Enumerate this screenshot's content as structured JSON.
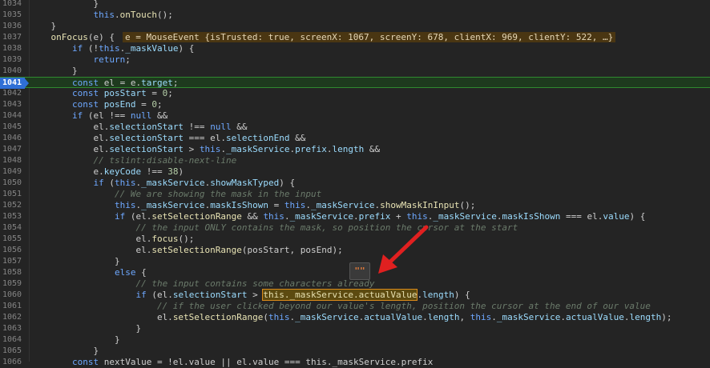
{
  "lines": [
    {
      "n": "1034",
      "segs": [
        {
          "t": "            }",
          "c": "op"
        }
      ]
    },
    {
      "n": "1035",
      "segs": [
        {
          "t": "            this",
          "c": "kw"
        },
        {
          "t": ".",
          "c": "op"
        },
        {
          "t": "onTouch",
          "c": "fn"
        },
        {
          "t": "();",
          "c": "op"
        }
      ]
    },
    {
      "n": "1036",
      "segs": [
        {
          "t": "    }",
          "c": "op"
        }
      ]
    },
    {
      "n": "1037",
      "segs": [
        {
          "t": "    onFocus",
          "c": "fn"
        },
        {
          "t": "(e) {",
          "c": "op"
        }
      ],
      "inline": "e = MouseEvent {isTrusted: true, screenX: 1067, screenY: 678, clientX: 969, clientY: 522, …}"
    },
    {
      "n": "1038",
      "segs": [
        {
          "t": "        if",
          "c": "kw"
        },
        {
          "t": " (!",
          "c": "op"
        },
        {
          "t": "this",
          "c": "kw"
        },
        {
          "t": ".",
          "c": "op"
        },
        {
          "t": "_maskValue",
          "c": "pr"
        },
        {
          "t": ") {",
          "c": "op"
        }
      ]
    },
    {
      "n": "1039",
      "segs": [
        {
          "t": "            return",
          "c": "kw"
        },
        {
          "t": ";",
          "c": "op"
        }
      ]
    },
    {
      "n": "1040",
      "segs": [
        {
          "t": "        }",
          "c": "op"
        }
      ]
    },
    {
      "n": "1041",
      "current": true,
      "segs": [
        {
          "t": "        const",
          "c": "kw"
        },
        {
          "t": " el = e.",
          "c": "op"
        },
        {
          "t": "target",
          "c": "pr"
        },
        {
          "t": ";",
          "c": "op"
        }
      ]
    },
    {
      "n": "1042",
      "segs": [
        {
          "t": "        const",
          "c": "kw"
        },
        {
          "t": " ",
          "c": "op"
        },
        {
          "t": "posStart",
          "c": "pr"
        },
        {
          "t": " = ",
          "c": "op"
        },
        {
          "t": "0",
          "c": "nm"
        },
        {
          "t": ";",
          "c": "op"
        }
      ]
    },
    {
      "n": "1043",
      "segs": [
        {
          "t": "        const",
          "c": "kw"
        },
        {
          "t": " ",
          "c": "op"
        },
        {
          "t": "posEnd",
          "c": "pr"
        },
        {
          "t": " = ",
          "c": "op"
        },
        {
          "t": "0",
          "c": "nm"
        },
        {
          "t": ";",
          "c": "op"
        }
      ]
    },
    {
      "n": "1044",
      "segs": [
        {
          "t": "        if",
          "c": "kw"
        },
        {
          "t": " (el !== ",
          "c": "op"
        },
        {
          "t": "null",
          "c": "kw"
        },
        {
          "t": " &&",
          "c": "op"
        }
      ]
    },
    {
      "n": "1045",
      "segs": [
        {
          "t": "            el.",
          "c": "op"
        },
        {
          "t": "selectionStart",
          "c": "pr"
        },
        {
          "t": " !== ",
          "c": "op"
        },
        {
          "t": "null",
          "c": "kw"
        },
        {
          "t": " &&",
          "c": "op"
        }
      ]
    },
    {
      "n": "1046",
      "segs": [
        {
          "t": "            el.",
          "c": "op"
        },
        {
          "t": "selectionStart",
          "c": "pr"
        },
        {
          "t": " === el.",
          "c": "op"
        },
        {
          "t": "selectionEnd",
          "c": "pr"
        },
        {
          "t": " &&",
          "c": "op"
        }
      ]
    },
    {
      "n": "1047",
      "segs": [
        {
          "t": "            el.",
          "c": "op"
        },
        {
          "t": "selectionStart",
          "c": "pr"
        },
        {
          "t": " > ",
          "c": "op"
        },
        {
          "t": "this",
          "c": "kw"
        },
        {
          "t": ".",
          "c": "op"
        },
        {
          "t": "_maskService",
          "c": "pr"
        },
        {
          "t": ".",
          "c": "op"
        },
        {
          "t": "prefix",
          "c": "pr"
        },
        {
          "t": ".",
          "c": "op"
        },
        {
          "t": "length",
          "c": "pr"
        },
        {
          "t": " &&",
          "c": "op"
        }
      ]
    },
    {
      "n": "1048",
      "segs": [
        {
          "t": "            // tslint:disable-next-line",
          "c": "cm"
        }
      ]
    },
    {
      "n": "1049",
      "segs": [
        {
          "t": "            e.",
          "c": "op"
        },
        {
          "t": "keyCode",
          "c": "pr"
        },
        {
          "t": " !== ",
          "c": "op"
        },
        {
          "t": "38",
          "c": "nm"
        },
        {
          "t": ")",
          "c": "op"
        }
      ]
    },
    {
      "n": "1050",
      "segs": [
        {
          "t": "            if",
          "c": "kw"
        },
        {
          "t": " (",
          "c": "op"
        },
        {
          "t": "this",
          "c": "kw"
        },
        {
          "t": ".",
          "c": "op"
        },
        {
          "t": "_maskService",
          "c": "pr"
        },
        {
          "t": ".",
          "c": "op"
        },
        {
          "t": "showMaskTyped",
          "c": "pr"
        },
        {
          "t": ") {",
          "c": "op"
        }
      ]
    },
    {
      "n": "1051",
      "segs": [
        {
          "t": "                // We are showing the mask in the input",
          "c": "cm"
        }
      ]
    },
    {
      "n": "1052",
      "segs": [
        {
          "t": "                this",
          "c": "kw"
        },
        {
          "t": ".",
          "c": "op"
        },
        {
          "t": "_maskService",
          "c": "pr"
        },
        {
          "t": ".",
          "c": "op"
        },
        {
          "t": "maskIsShown",
          "c": "pr"
        },
        {
          "t": " = ",
          "c": "op"
        },
        {
          "t": "this",
          "c": "kw"
        },
        {
          "t": ".",
          "c": "op"
        },
        {
          "t": "_maskService",
          "c": "pr"
        },
        {
          "t": ".",
          "c": "op"
        },
        {
          "t": "showMaskInInput",
          "c": "fn"
        },
        {
          "t": "();",
          "c": "op"
        }
      ]
    },
    {
      "n": "1053",
      "segs": [
        {
          "t": "                if",
          "c": "kw"
        },
        {
          "t": " (el.",
          "c": "op"
        },
        {
          "t": "setSelectionRange",
          "c": "fn"
        },
        {
          "t": " && ",
          "c": "op"
        },
        {
          "t": "this",
          "c": "kw"
        },
        {
          "t": ".",
          "c": "op"
        },
        {
          "t": "_maskService",
          "c": "pr"
        },
        {
          "t": ".",
          "c": "op"
        },
        {
          "t": "prefix",
          "c": "pr"
        },
        {
          "t": " + ",
          "c": "op"
        },
        {
          "t": "this",
          "c": "kw"
        },
        {
          "t": ".",
          "c": "op"
        },
        {
          "t": "_maskService",
          "c": "pr"
        },
        {
          "t": ".",
          "c": "op"
        },
        {
          "t": "maskIsShown",
          "c": "pr"
        },
        {
          "t": " === el.",
          "c": "op"
        },
        {
          "t": "value",
          "c": "pr"
        },
        {
          "t": ") {",
          "c": "op"
        }
      ]
    },
    {
      "n": "1054",
      "segs": [
        {
          "t": "                    // the input ONLY contains the mask, so position the cursor at the start",
          "c": "cm"
        }
      ]
    },
    {
      "n": "1055",
      "segs": [
        {
          "t": "                    el.",
          "c": "op"
        },
        {
          "t": "focus",
          "c": "fn"
        },
        {
          "t": "();",
          "c": "op"
        }
      ]
    },
    {
      "n": "1056",
      "segs": [
        {
          "t": "                    el.",
          "c": "op"
        },
        {
          "t": "setSelectionRange",
          "c": "fn"
        },
        {
          "t": "(posStart, posEnd);",
          "c": "op"
        }
      ]
    },
    {
      "n": "1057",
      "segs": [
        {
          "t": "                }",
          "c": "op"
        }
      ]
    },
    {
      "n": "1058",
      "segs": [
        {
          "t": "                else",
          "c": "kw"
        },
        {
          "t": " {",
          "c": "op"
        }
      ]
    },
    {
      "n": "1059",
      "segs": [
        {
          "t": "                    // the input contains some characters alr",
          "c": "cm"
        },
        {
          "t": "eady",
          "c": "cm"
        }
      ]
    },
    {
      "n": "1060",
      "segs": [
        {
          "t": "                    if",
          "c": "kw"
        },
        {
          "t": " (el.",
          "c": "op"
        },
        {
          "t": "selectionStart",
          "c": "pr"
        },
        {
          "t": " > ",
          "c": "op"
        },
        {
          "t": "this._maskService.actualValue",
          "c": "hl"
        },
        {
          "t": ".",
          "c": "op"
        },
        {
          "t": "length",
          "c": "pr"
        },
        {
          "t": ") {",
          "c": "op"
        }
      ]
    },
    {
      "n": "1061",
      "segs": [
        {
          "t": "                        // if the user clicked beyond our value's length, position the cursor at the end of our value",
          "c": "cm"
        }
      ]
    },
    {
      "n": "1062",
      "segs": [
        {
          "t": "                        el.",
          "c": "op"
        },
        {
          "t": "setSelectionRange",
          "c": "fn"
        },
        {
          "t": "(",
          "c": "op"
        },
        {
          "t": "this",
          "c": "kw"
        },
        {
          "t": ".",
          "c": "op"
        },
        {
          "t": "_maskService",
          "c": "pr"
        },
        {
          "t": ".",
          "c": "op"
        },
        {
          "t": "actualValue",
          "c": "pr"
        },
        {
          "t": ".",
          "c": "op"
        },
        {
          "t": "length",
          "c": "pr"
        },
        {
          "t": ", ",
          "c": "op"
        },
        {
          "t": "this",
          "c": "kw"
        },
        {
          "t": ".",
          "c": "op"
        },
        {
          "t": "_maskService",
          "c": "pr"
        },
        {
          "t": ".",
          "c": "op"
        },
        {
          "t": "actualValue",
          "c": "pr"
        },
        {
          "t": ".",
          "c": "op"
        },
        {
          "t": "length",
          "c": "pr"
        },
        {
          "t": ");",
          "c": "op"
        }
      ]
    },
    {
      "n": "1063",
      "segs": [
        {
          "t": "                    }",
          "c": "op"
        }
      ]
    },
    {
      "n": "1064",
      "segs": [
        {
          "t": "                }",
          "c": "op"
        }
      ]
    },
    {
      "n": "1065",
      "segs": [
        {
          "t": "            }",
          "c": "op"
        }
      ]
    },
    {
      "n": "1066",
      "segs": [
        {
          "t": "        const",
          "c": "kw"
        },
        {
          "t": " nextValue = !el.value || el.value === this._maskService.prefix",
          "c": "op"
        }
      ]
    }
  ],
  "hover_tooltip": {
    "text": "\"\""
  },
  "colors": {
    "accent": "#2f6fd6",
    "arrow": "#e02020",
    "highlight": "#d98a1a"
  }
}
